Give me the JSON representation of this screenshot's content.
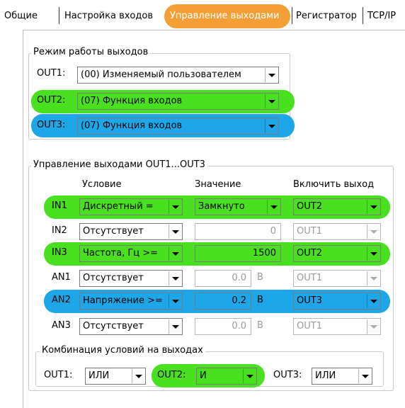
{
  "tabs": [
    {
      "label": "Общие",
      "active": false
    },
    {
      "label": "Настройка входов",
      "active": false
    },
    {
      "label": "Управление выходами",
      "active": true
    },
    {
      "label": "Регистратор",
      "active": false
    },
    {
      "label": "TCP/IP",
      "active": false
    }
  ],
  "highlight_colors": {
    "tab": "#f39a2a",
    "green": "#49e01f",
    "blue": "#1ea7e8"
  },
  "output_mode": {
    "title": "Режим работы выходов",
    "rows": [
      {
        "label": "OUT1:",
        "value": "(00) Изменяемый пользователем",
        "highlight": "none"
      },
      {
        "label": "OUT2:",
        "value": "(07) Функция входов",
        "highlight": "green"
      },
      {
        "label": "OUT3:",
        "value": "(07) Функция входов",
        "highlight": "blue"
      }
    ]
  },
  "control": {
    "title": "Управление выходами OUT1...OUT3",
    "headers": {
      "condition": "Условие",
      "value": "Значение",
      "enable": "Включить выход"
    },
    "rows": [
      {
        "input": "IN1",
        "condition": "Дискретный =",
        "value": "Замкнуто",
        "value_is_combo": true,
        "unit": "",
        "output": "OUT2",
        "highlight": "green",
        "enabled": true
      },
      {
        "input": "IN2",
        "condition": "Отсутствует",
        "value": "0",
        "value_is_combo": false,
        "unit": "",
        "output": "OUT1",
        "highlight": "none",
        "enabled": false
      },
      {
        "input": "IN3",
        "condition": "Частота, Гц >=",
        "value": "1500",
        "value_is_combo": false,
        "unit": "",
        "output": "OUT2",
        "highlight": "green",
        "enabled": true
      },
      {
        "input": "AN1",
        "condition": "Отсутствует",
        "value": "0.0",
        "value_is_combo": false,
        "unit": "В",
        "output": "OUT1",
        "highlight": "none",
        "enabled": false
      },
      {
        "input": "AN2",
        "condition": "Напряжение >=",
        "value": "0.2",
        "value_is_combo": false,
        "unit": "В",
        "output": "OUT3",
        "highlight": "blue",
        "enabled": true
      },
      {
        "input": "AN3",
        "condition": "Отсутствует",
        "value": "0.0",
        "value_is_combo": false,
        "unit": "В",
        "output": "OUT1",
        "highlight": "none",
        "enabled": false
      }
    ]
  },
  "combination": {
    "title": "Комбинация условий на выходах",
    "items": [
      {
        "label": "OUT1:",
        "value": "ИЛИ",
        "highlight": "none"
      },
      {
        "label": "OUT2:",
        "value": "И",
        "highlight": "green"
      },
      {
        "label": "OUT3:",
        "value": "ИЛИ",
        "highlight": "none"
      }
    ]
  }
}
